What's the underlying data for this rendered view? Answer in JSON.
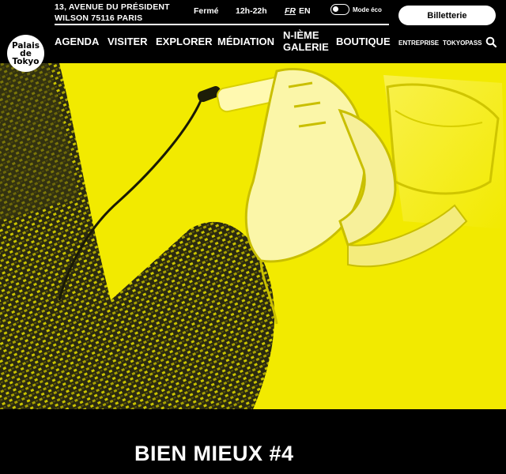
{
  "header": {
    "address_line1": "13, avenue du Président",
    "address_line2": "Wilson 75116 Paris",
    "status": "Fermé",
    "hours": "12h-22h",
    "lang_fr": "FR",
    "lang_en": "EN",
    "eco_label": "Mode éco",
    "ticket_button": "Billetterie"
  },
  "logo": {
    "line1": "Palais",
    "line2": "de",
    "line3": "Tokyo"
  },
  "nav": {
    "items": [
      "AGENDA",
      "VISITER",
      "EXPLORER",
      "MÉDIATION",
      "N-IÈME GALERIE",
      "BOUTIQUE"
    ],
    "secondary": [
      "ENTREPRISE",
      "TOKYOPASS"
    ],
    "search_icon": "search-icon"
  },
  "hero": {
    "title": "BIEN MIEUX #4"
  },
  "colors": {
    "accent": "#f2ea00",
    "background": "#000000",
    "text": "#ffffff"
  }
}
